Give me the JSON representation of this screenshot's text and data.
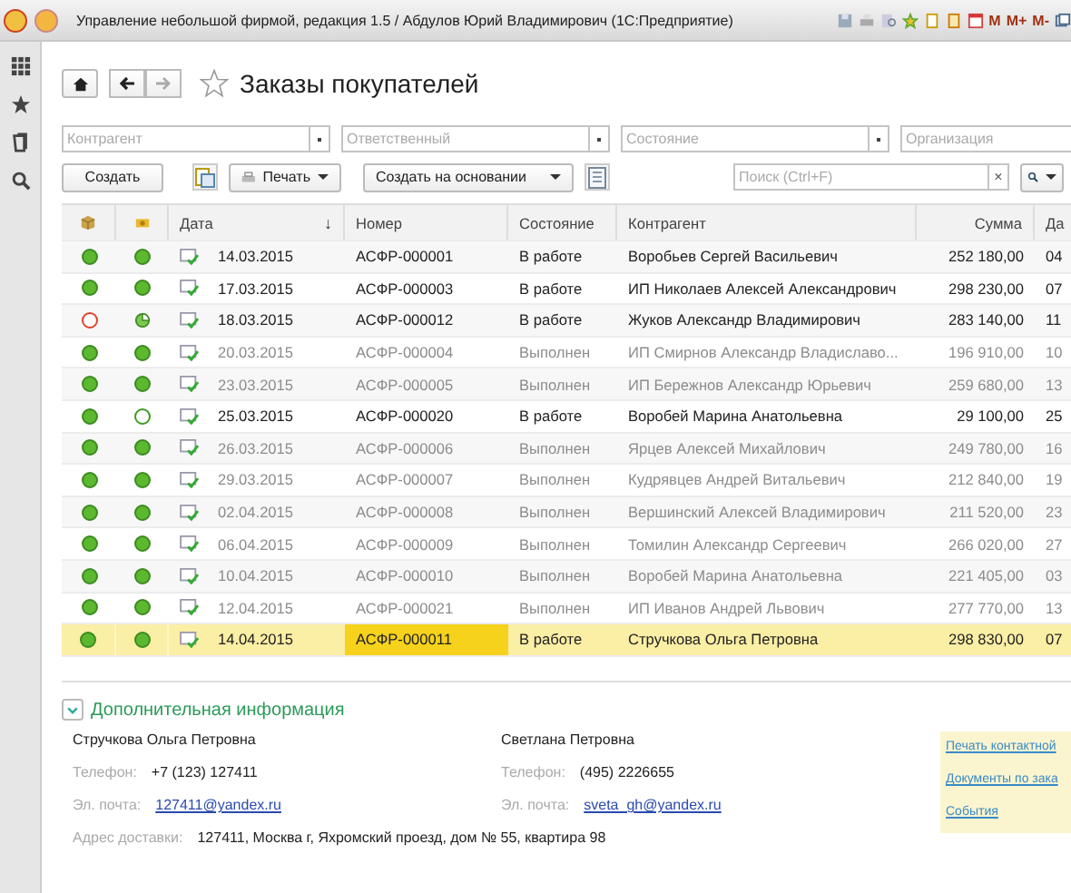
{
  "window": {
    "title": "Управление небольшой фирмой, редакция 1.5 / Абдулов Юрий Владимирович  (1С:Предприятие)",
    "memory_buttons": [
      "M",
      "M+",
      "M-"
    ]
  },
  "page": {
    "title": "Заказы покупателей",
    "favorite": false
  },
  "filters": [
    {
      "placeholder": "Контрагент"
    },
    {
      "placeholder": "Ответственный"
    },
    {
      "placeholder": "Состояние"
    },
    {
      "placeholder": "Организация"
    }
  ],
  "toolbar": {
    "create": "Создать",
    "print": "Печать",
    "create_based": "Создать на основании",
    "search": {
      "placeholder": "Поиск (Ctrl+F)"
    },
    "clear": "×"
  },
  "table": {
    "columns": [
      "",
      "",
      "Дата",
      "Номер",
      "Состояние",
      "Контрагент",
      "Сумма",
      "Да"
    ],
    "sort_mark": "↓",
    "rows": [
      {
        "shipment": {
          "kind": "filled",
          "color": "#5cb82e"
        },
        "payment": {
          "kind": "filled"
        },
        "date": "14.03.2015",
        "number": "АСФР-000001",
        "state": "В работе",
        "contractor": "Воробьев Сергей Васильевич",
        "sum": "252 180,00",
        "column_8": "04",
        "completed": false,
        "selected": false
      },
      {
        "shipment": {
          "kind": "filled",
          "color": "#5cb82e"
        },
        "payment": {
          "kind": "filled"
        },
        "date": "17.03.2015",
        "number": "АСФР-000003",
        "state": "В работе",
        "contractor": "ИП Николаев Алексей Александрович",
        "sum": "298 230,00",
        "column_8": "07",
        "completed": false,
        "selected": false
      },
      {
        "shipment": {
          "kind": "ring",
          "color": "#e0402a"
        },
        "payment": {
          "kind": "partial"
        },
        "date": "18.03.2015",
        "number": "АСФР-000012",
        "state": "В работе",
        "contractor": "Жуков Александр Владимирович",
        "sum": "283 140,00",
        "column_8": "11",
        "completed": false,
        "selected": false
      },
      {
        "shipment": {
          "kind": "filled",
          "color": "#5cb82e"
        },
        "payment": {
          "kind": "filled"
        },
        "date": "20.03.2015",
        "number": "АСФР-000004",
        "state": "Выполнен",
        "contractor": "ИП Смирнов Александр Владиславо...",
        "sum": "196 910,00",
        "column_8": "10",
        "completed": true,
        "selected": false
      },
      {
        "shipment": {
          "kind": "filled",
          "color": "#5cb82e"
        },
        "payment": {
          "kind": "filled"
        },
        "date": "23.03.2015",
        "number": "АСФР-000005",
        "state": "Выполнен",
        "contractor": "ИП Бережнов Александр Юрьевич",
        "sum": "259 680,00",
        "column_8": "13",
        "completed": true,
        "selected": false
      },
      {
        "shipment": {
          "kind": "filled",
          "color": "#5cb82e"
        },
        "payment": {
          "kind": "ring"
        },
        "date": "25.03.2015",
        "number": "АСФР-000020",
        "state": "В работе",
        "contractor": "Воробей Марина Анатольевна",
        "sum": "29 100,00",
        "column_8": "25",
        "completed": false,
        "selected": false
      },
      {
        "shipment": {
          "kind": "filled",
          "color": "#5cb82e"
        },
        "payment": {
          "kind": "filled"
        },
        "date": "26.03.2015",
        "number": "АСФР-000006",
        "state": "Выполнен",
        "contractor": "Ярцев Алексей Михайлович",
        "sum": "249 780,00",
        "column_8": "16",
        "completed": true,
        "selected": false
      },
      {
        "shipment": {
          "kind": "filled",
          "color": "#5cb82e"
        },
        "payment": {
          "kind": "filled"
        },
        "date": "29.03.2015",
        "number": "АСФР-000007",
        "state": "Выполнен",
        "contractor": "Кудрявцев Андрей Витальевич",
        "sum": "212 840,00",
        "column_8": "19",
        "completed": true,
        "selected": false
      },
      {
        "shipment": {
          "kind": "filled",
          "color": "#5cb82e"
        },
        "payment": {
          "kind": "filled"
        },
        "date": "02.04.2015",
        "number": "АСФР-000008",
        "state": "Выполнен",
        "contractor": "Вершинский Алексей Владимирович",
        "sum": "211 520,00",
        "column_8": "23",
        "completed": true,
        "selected": false
      },
      {
        "shipment": {
          "kind": "filled",
          "color": "#5cb82e"
        },
        "payment": {
          "kind": "filled"
        },
        "date": "06.04.2015",
        "number": "АСФР-000009",
        "state": "Выполнен",
        "contractor": "Томилин Александр Сергеевич",
        "sum": "266 020,00",
        "column_8": "27",
        "completed": true,
        "selected": false
      },
      {
        "shipment": {
          "kind": "filled",
          "color": "#5cb82e"
        },
        "payment": {
          "kind": "filled"
        },
        "date": "10.04.2015",
        "number": "АСФР-000010",
        "state": "Выполнен",
        "contractor": "Воробей Марина Анатольевна",
        "sum": "221 405,00",
        "column_8": "03",
        "completed": true,
        "selected": false
      },
      {
        "shipment": {
          "kind": "filled",
          "color": "#5cb82e"
        },
        "payment": {
          "kind": "filled"
        },
        "date": "12.04.2015",
        "number": "АСФР-000021",
        "state": "Выполнен",
        "contractor": "ИП Иванов Андрей Львович",
        "sum": "277 770,00",
        "column_8": "13",
        "completed": true,
        "selected": false
      },
      {
        "shipment": {
          "kind": "filled",
          "color": "#5cb82e"
        },
        "payment": {
          "kind": "filled"
        },
        "date": "14.04.2015",
        "number": "АСФР-000011",
        "state": "В работе",
        "contractor": "Стручкова Ольга Петровна",
        "sum": "298 830,00",
        "column_8": "07",
        "completed": false,
        "selected": true
      }
    ]
  },
  "details": {
    "title": "Дополнительная информация",
    "expanded": true,
    "contacts": [
      {
        "name": "Стручкова Ольга Петровна",
        "phone_label": "Телефон:",
        "phone": "+7 (123) 127411",
        "email_label": "Эл. почта:",
        "email": "127411@yandex.ru"
      },
      {
        "name": "Светлана Петровна",
        "phone_label": "Телефон:",
        "phone": "(495) 2226655",
        "email_label": "Эл. почта:",
        "email": "sveta_gh@yandex.ru"
      }
    ],
    "address_label": "Адрес доставки:",
    "address": "127411, Москва г, Яхромский проезд, дом № 55, квартира 98",
    "links": [
      "Печать контактной",
      "Документы по зака",
      "События"
    ]
  }
}
